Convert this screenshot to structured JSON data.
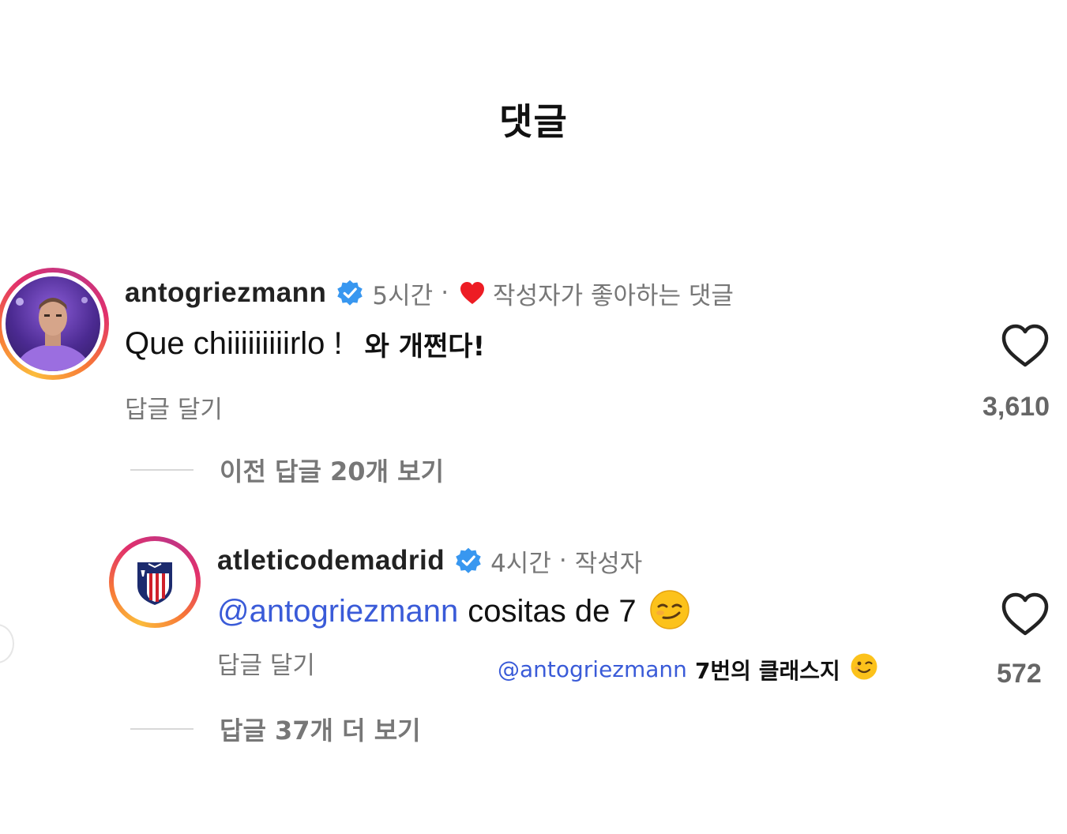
{
  "header": {
    "title": "댓글"
  },
  "comments": [
    {
      "username": "antogriezmann",
      "time": "5시간",
      "separator": "·",
      "liked_by_author": "작성자가 좋아하는 댓글",
      "text": "Que chiiiiiiiiirlo !",
      "translation": "와 개쩐다!",
      "reply_label": "답글 달기",
      "like_count": "3,610",
      "view_replies": "이전 답글 20개 보기"
    },
    {
      "username": "atleticodemadrid",
      "time": "4시간",
      "separator": "·",
      "author_badge": "작성자",
      "mention": "@antogriezmann",
      "text": "cositas de 7",
      "reply_label": "답글 달기",
      "translation_mention": "@antogriezmann",
      "translation": "7번의 클래스지",
      "like_count": "572",
      "view_replies": "답글 37개 더 보기"
    }
  ],
  "icons": {
    "verified": "verified-badge-icon",
    "heart_outline": "heart-outline-icon",
    "heart_filled": "heart-filled-icon",
    "smirk": "smirking-face-emoji",
    "wink": "winking-face-emoji"
  },
  "colors": {
    "verified": "#3897f0",
    "heart_red": "#ed1c24",
    "mention": "#3a5bd8",
    "secondary_text": "#777777"
  }
}
